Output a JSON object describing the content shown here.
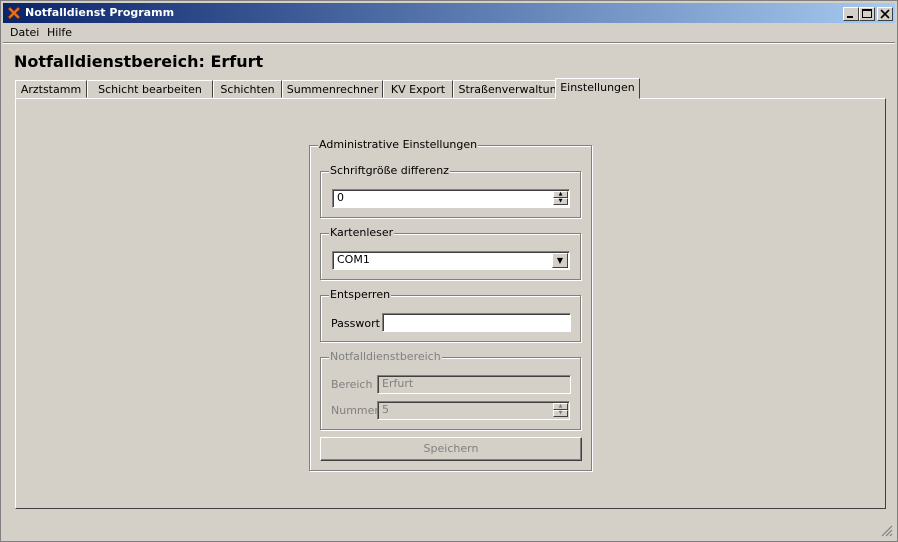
{
  "window": {
    "title": "Notfalldienst Programm"
  },
  "menu": [
    "Datei",
    "Hilfe"
  ],
  "heading": "Notfalldienstbereich: Erfurt",
  "tabs": [
    "Arztstamm",
    "Schicht bearbeiten",
    "Schichten",
    "Summenrechner",
    "KV Export",
    "Straßenverwaltung",
    "Einstellungen"
  ],
  "active_tab": "Einstellungen",
  "settings": {
    "title": "Administrative Einstellungen",
    "font": {
      "title": "Schriftgröße differenz",
      "value": "0"
    },
    "card": {
      "title": "Kartenleser",
      "value": "COM1"
    },
    "unlock": {
      "title": "Entsperren",
      "label": "Passwort",
      "value": ""
    },
    "area": {
      "title": "Notfalldienstbereich",
      "bereich_label": "Bereich",
      "bereich_value": "Erfurt",
      "nummer_label": "Nummer",
      "nummer_value": "5"
    },
    "save": "Speichern"
  },
  "icons": [
    "app-icon",
    "minimize-icon",
    "maximize-icon",
    "close-icon",
    "resize-grip-icon"
  ]
}
